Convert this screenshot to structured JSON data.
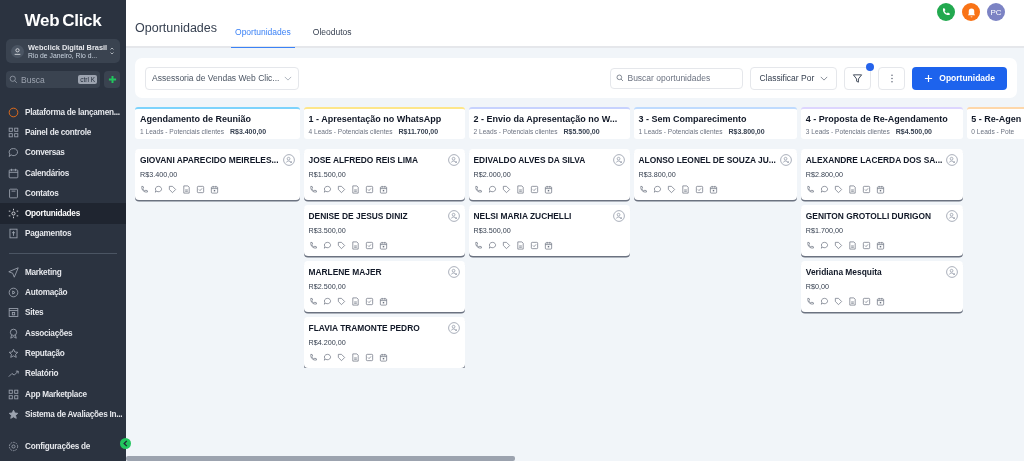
{
  "sidebar": {
    "logo": {
      "part1": "Web",
      "part2": "Click"
    },
    "account": {
      "name": "Webclick Digital Brasil",
      "location": "Rio de Janeiro, Rio d..."
    },
    "search": {
      "placeholder": "Busca",
      "shortcut": "ctrl K"
    },
    "items": [
      {
        "label": "Plataforma de lançamen...",
        "selected": false
      },
      {
        "label": "Painel de controle",
        "selected": false
      },
      {
        "label": "Conversas",
        "selected": false
      },
      {
        "label": "Calendários",
        "selected": false
      },
      {
        "label": "Contatos",
        "selected": false
      },
      {
        "label": "Oportunidades",
        "selected": true
      },
      {
        "label": "Pagamentos",
        "selected": false
      }
    ],
    "items2": [
      {
        "label": "Marketing",
        "selected": false
      },
      {
        "label": "Automação",
        "selected": false
      },
      {
        "label": "Sites",
        "selected": false
      },
      {
        "label": "Associações",
        "selected": false
      },
      {
        "label": "Reputação",
        "selected": false
      },
      {
        "label": "Relatório",
        "selected": false
      },
      {
        "label": "App Marketplace",
        "selected": false
      },
      {
        "label": "Sistema de Avaliações In...",
        "selected": false
      }
    ],
    "settings": "Configurações de"
  },
  "header": {
    "title": "Oportunidades",
    "tabs": [
      {
        "label": "Oportunidades",
        "selected": true
      },
      {
        "label": "Oleodutos",
        "selected": false
      }
    ],
    "avatar": "PC"
  },
  "toolbar": {
    "pipeline": "Assessoria de Vendas Web Clic...",
    "search_placeholder": "Buscar oportunidades",
    "sort": "Classificar Por",
    "filter_active": true,
    "add_button": "Oportunidade"
  },
  "columns": [
    {
      "title": "Agendamento de Reunião",
      "leads": "1 Leads - Potenciais clientes",
      "total": "R$3.400,00",
      "color": "#7dd3fc",
      "cards": [
        {
          "name": "GIOVANI APARECIDO MEIRELES...",
          "value": "R$3.400,00"
        }
      ]
    },
    {
      "title": "1 - Apresentação no WhatsApp",
      "leads": "4 Leads - Potenciais clientes",
      "total": "R$11.700,00",
      "color": "#fde68a",
      "cards": [
        {
          "name": "JOSE ALFREDO REIS LIMA",
          "value": "R$1.500,00"
        },
        {
          "name": "DENISE DE JESUS DINIZ",
          "value": "R$3.500,00"
        },
        {
          "name": "MARLENE MAJER",
          "value": "R$2.500,00"
        },
        {
          "name": "FLAVIA TRAMONTE PEDRO",
          "value": "R$4.200,00"
        }
      ]
    },
    {
      "title": "2 - Envio da Apresentação no W...",
      "leads": "2 Leads - Potenciais clientes",
      "total": "R$5.500,00",
      "color": "#c7d2fe",
      "cards": [
        {
          "name": "EDIVALDO ALVES DA SILVA",
          "value": "R$2.000,00"
        },
        {
          "name": "NELSI MARIA ZUCHELLI",
          "value": "R$3.500,00"
        }
      ]
    },
    {
      "title": "3 - Sem Comparecimento",
      "leads": "1 Leads - Potenciais clientes",
      "total": "R$3.800,00",
      "color": "#bfdbfe",
      "cards": [
        {
          "name": "ALONSO LEONEL DE SOUZA JU...",
          "value": "R$3.800,00"
        }
      ]
    },
    {
      "title": "4 - Proposta de Re-Agendamento",
      "leads": "3 Leads - Potenciais clientes",
      "total": "R$4.500,00",
      "color": "#ddd6fe",
      "cards": [
        {
          "name": "ALEXANDRE LACERDA DOS SA...",
          "value": "R$2.800,00"
        },
        {
          "name": "GENITON GROTOLLI DURIGON",
          "value": "R$1.700,00"
        },
        {
          "name": "Veridiana Mesquita",
          "value": "R$0,00"
        }
      ]
    },
    {
      "title": "5 - Re-Agen",
      "leads": "0 Leads - Pote",
      "color": "#fed7aa"
    }
  ]
}
